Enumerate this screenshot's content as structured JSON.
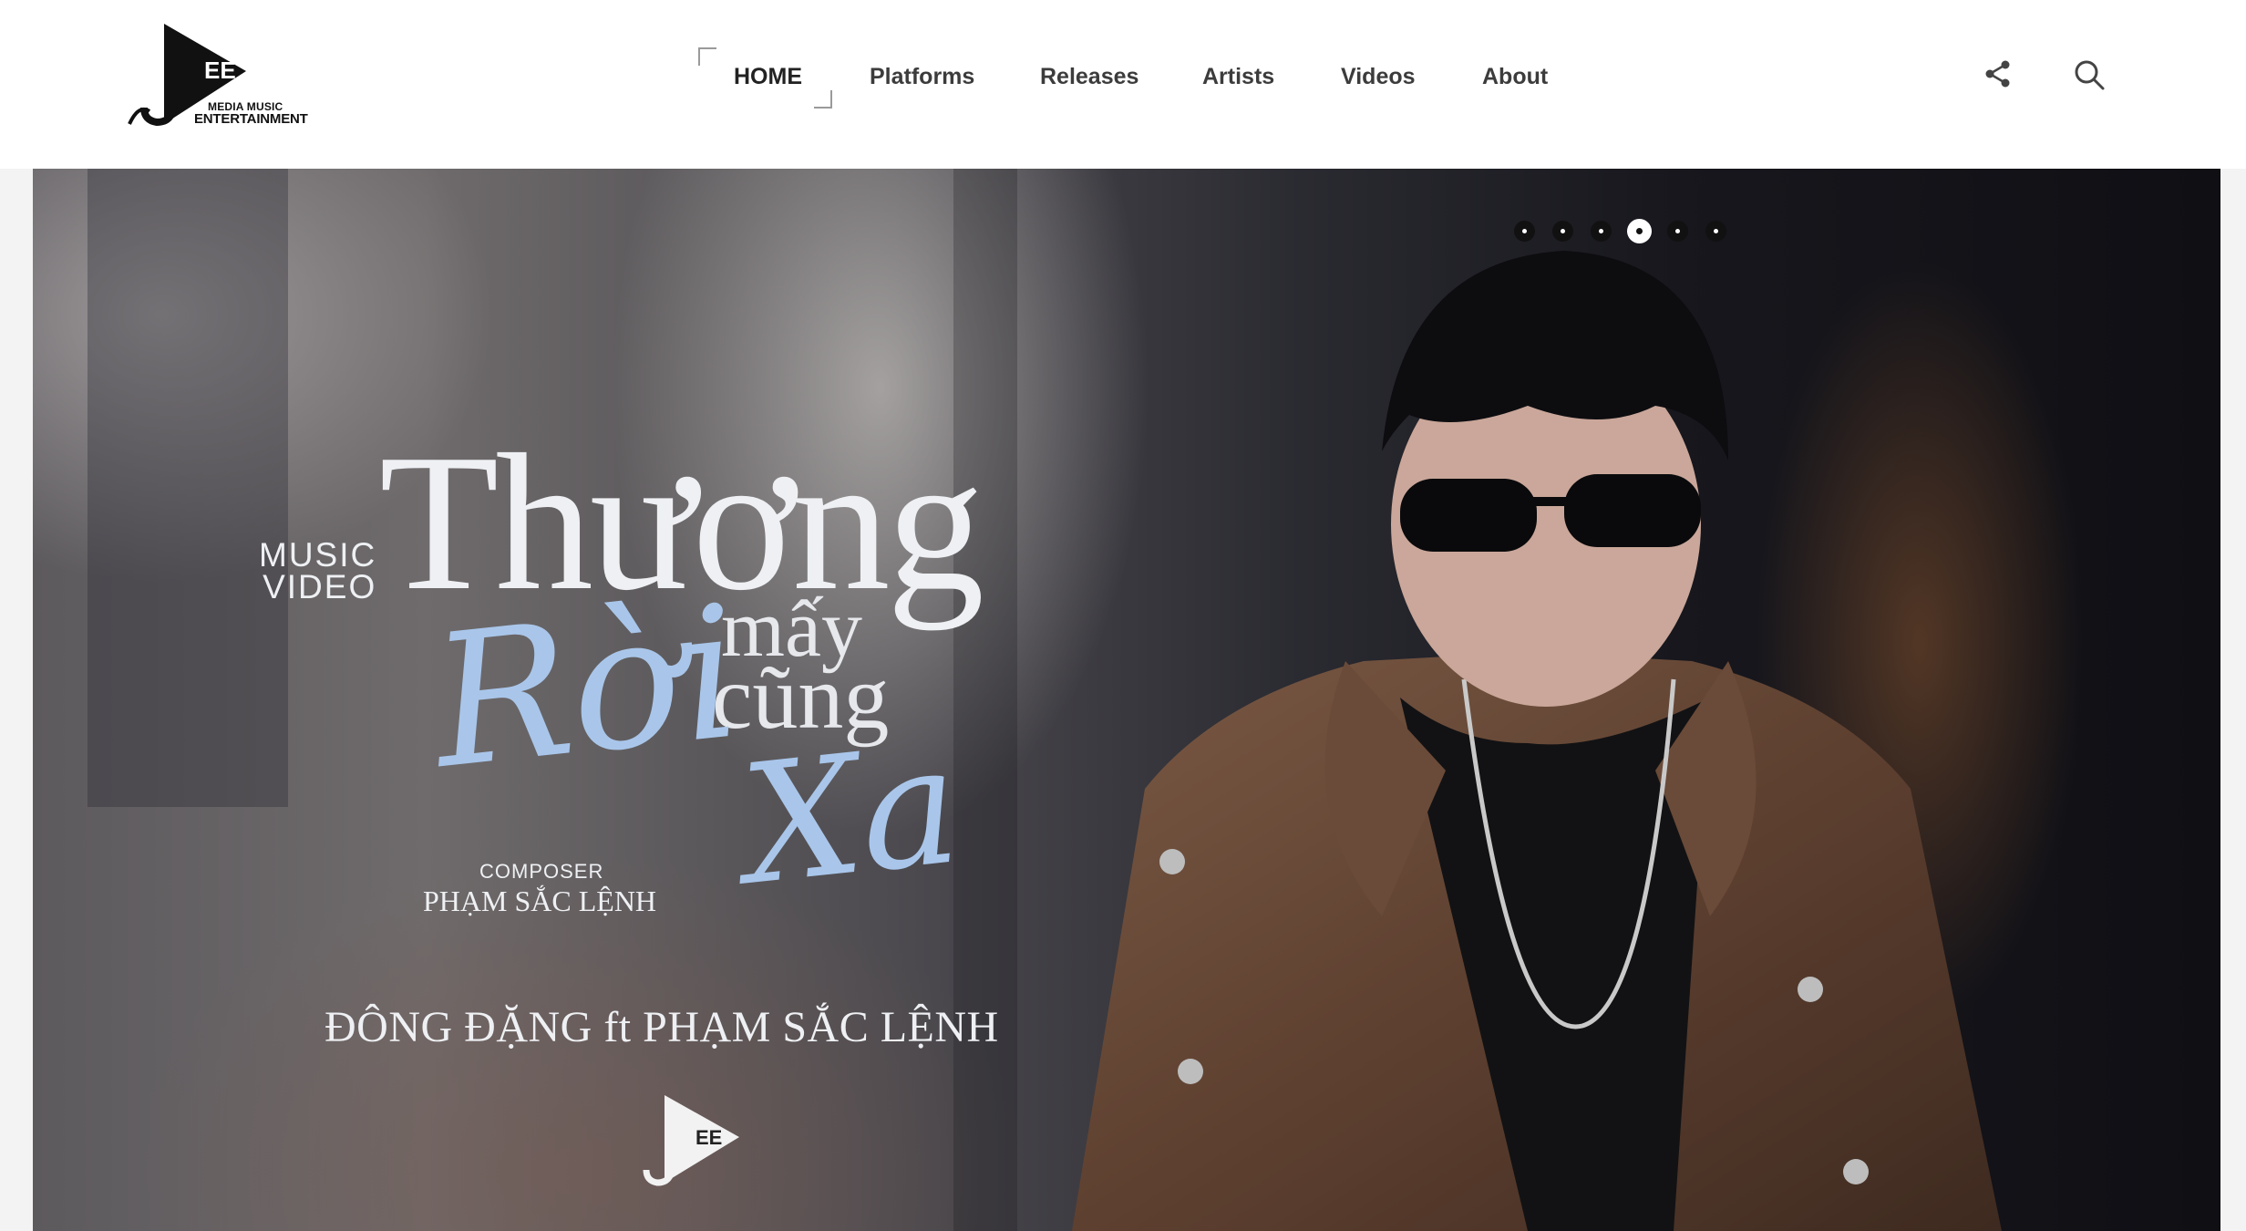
{
  "header": {
    "logo": {
      "mark_text": "EE",
      "sub_text": "MEDIA MUSIC",
      "main_text": "ENTERTAINMENT"
    },
    "nav": [
      {
        "label": "HOME",
        "active": true
      },
      {
        "label": "Platforms",
        "active": false
      },
      {
        "label": "Releases",
        "active": false
      },
      {
        "label": "Artists",
        "active": false
      },
      {
        "label": "Videos",
        "active": false
      },
      {
        "label": "About",
        "active": false
      }
    ],
    "icons": [
      "share-icon",
      "search-icon"
    ]
  },
  "hero": {
    "slides_count": 6,
    "active_slide": 4,
    "poster": {
      "label": "MUSIC\nVIDEO",
      "title_line1": "Thương",
      "title_line2": "mấy",
      "title_line3": "cũng",
      "title_script1": "Rời",
      "title_script2": "Xa",
      "composer_label": "COMPOSER",
      "composer_name": "PHẠM SẮC LỆNH",
      "artists": "ĐÔNG ĐẶNG ft PHẠM SẮC LỆNH",
      "logo_text": "EE"
    }
  },
  "colors": {
    "header_bg": "#ffffff",
    "nav_text": "#3c3c3c",
    "page_bg": "#f3f3f3",
    "script_accent": "#a9c6ea"
  }
}
